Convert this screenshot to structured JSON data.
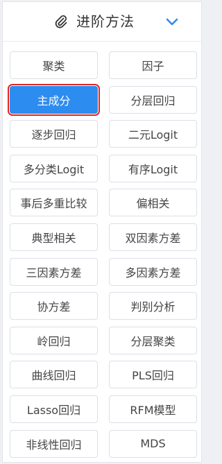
{
  "header": {
    "title": "进阶方法",
    "icon": "paperclip-icon",
    "toggle_icon": "chevron-down-icon",
    "accent_color": "#2d8cf0"
  },
  "methods": [
    {
      "label": "聚类",
      "name": "method-button-clustering"
    },
    {
      "label": "因子",
      "name": "method-button-factor"
    },
    {
      "label": "主成分",
      "name": "method-button-pca",
      "selected": true
    },
    {
      "label": "分层回归",
      "name": "method-button-hierarchical-regression"
    },
    {
      "label": "逐步回归",
      "name": "method-button-stepwise-regression"
    },
    {
      "label": "二元Logit",
      "name": "method-button-binary-logit"
    },
    {
      "label": "多分类Logit",
      "name": "method-button-multinomial-logit"
    },
    {
      "label": "有序Logit",
      "name": "method-button-ordinal-logit"
    },
    {
      "label": "事后多重比较",
      "name": "method-button-post-hoc"
    },
    {
      "label": "偏相关",
      "name": "method-button-partial-correlation"
    },
    {
      "label": "典型相关",
      "name": "method-button-canonical-correlation"
    },
    {
      "label": "双因素方差",
      "name": "method-button-two-way-anova"
    },
    {
      "label": "三因素方差",
      "name": "method-button-three-way-anova"
    },
    {
      "label": "多因素方差",
      "name": "method-button-multi-way-anova"
    },
    {
      "label": "协方差",
      "name": "method-button-ancova"
    },
    {
      "label": "判别分析",
      "name": "method-button-discriminant"
    },
    {
      "label": "岭回归",
      "name": "method-button-ridge-regression"
    },
    {
      "label": "分层聚类",
      "name": "method-button-hierarchical-clustering"
    },
    {
      "label": "曲线回归",
      "name": "method-button-curve-regression"
    },
    {
      "label": "PLS回归",
      "name": "method-button-pls-regression"
    },
    {
      "label": "Lasso回归",
      "name": "method-button-lasso-regression"
    },
    {
      "label": "RFM模型",
      "name": "method-button-rfm-model"
    },
    {
      "label": "非线性回归",
      "name": "method-button-nonlinear-regression"
    },
    {
      "label": "MDS",
      "name": "method-button-mds"
    }
  ]
}
